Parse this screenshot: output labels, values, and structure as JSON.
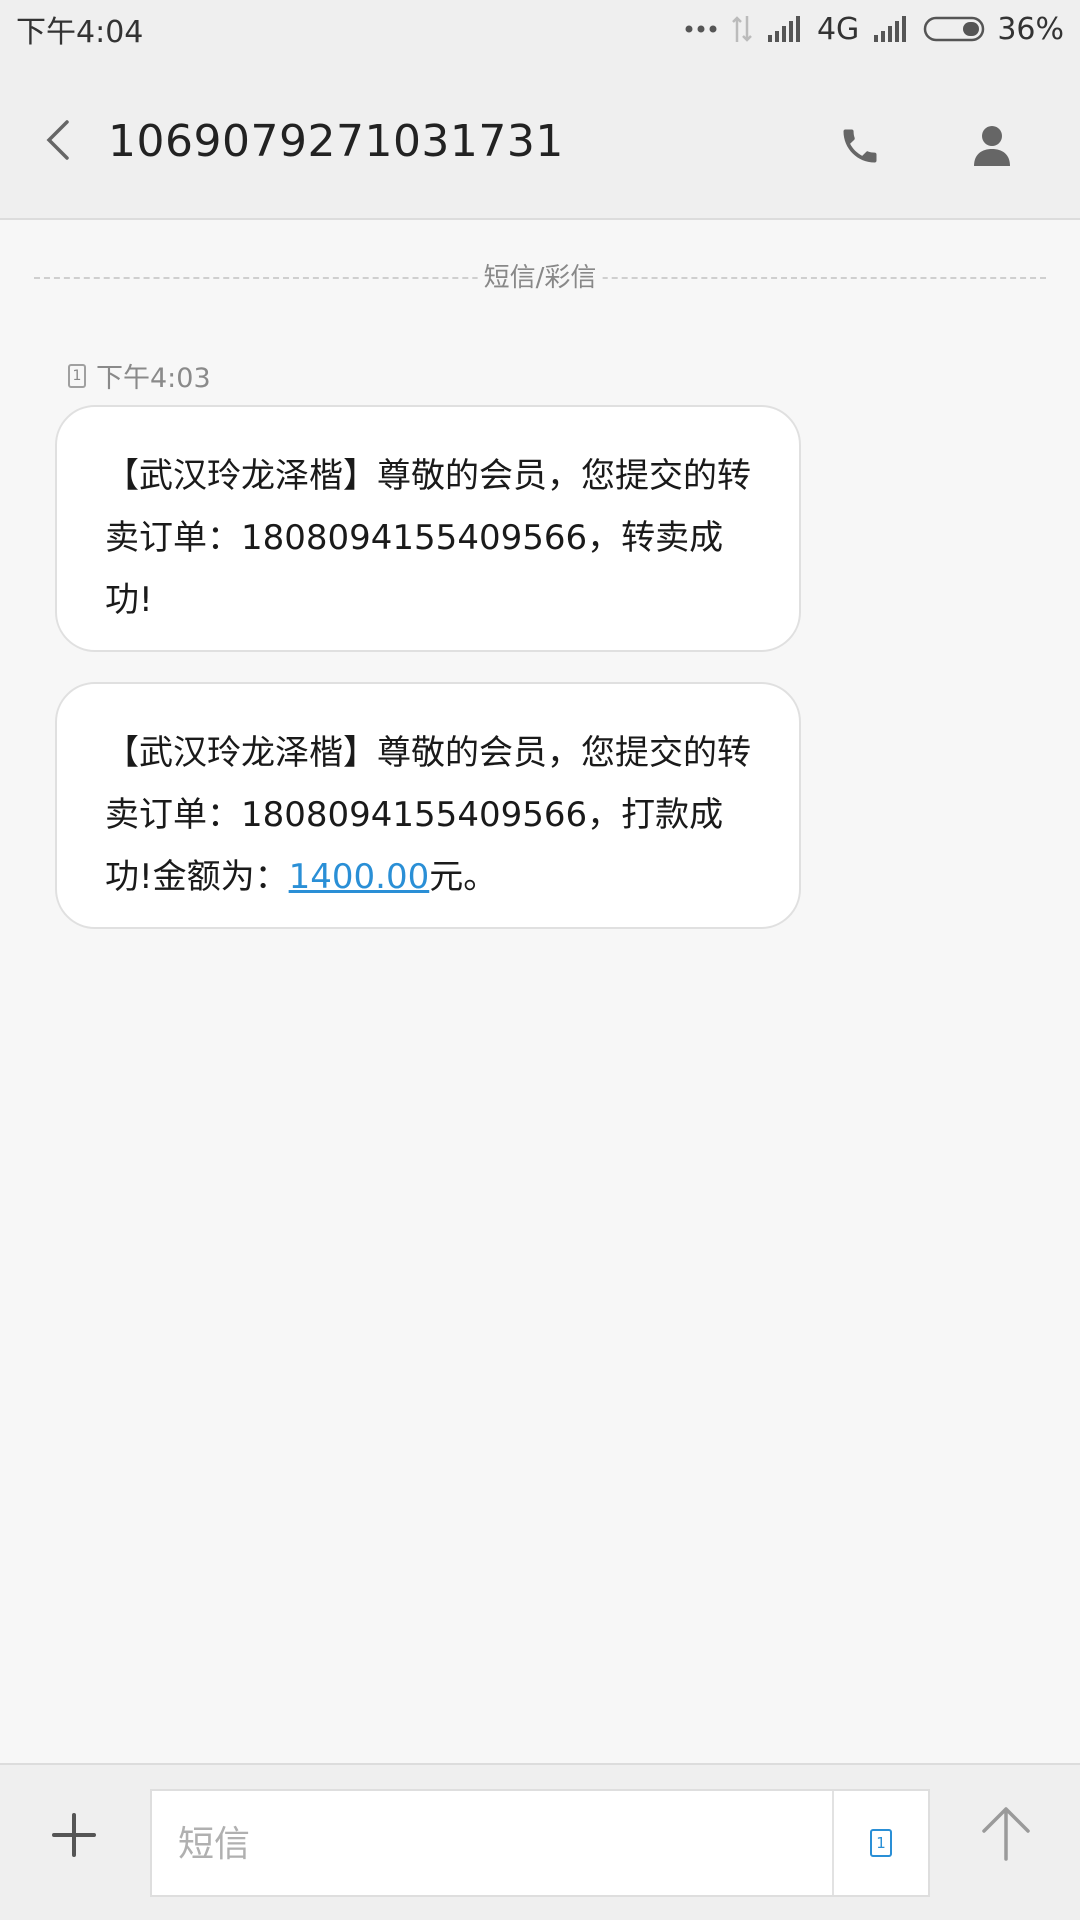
{
  "status_bar": {
    "time": "下午4:04",
    "network": "4G",
    "battery": "36%"
  },
  "header": {
    "title": "1069079271031731",
    "back_icon": "chevron-left-icon",
    "call_icon": "phone-icon",
    "contact_icon": "person-icon"
  },
  "thread": {
    "divider_label": "短信/彩信",
    "timestamp": "下午4:03",
    "sim_slot": "1",
    "messages": [
      {
        "text": "【武汉玲龙泽楷】尊敬的会员，您提交的转卖订单：1808094155409566，转卖成功!"
      },
      {
        "text_before": "【武汉玲龙泽楷】尊敬的会员，您提交的转卖订单：1808094155409566，打款成功!金额为：",
        "amount": "1400.00",
        "text_after": "元。"
      }
    ]
  },
  "composer": {
    "placeholder": "短信",
    "sim_slot": "1",
    "plus_icon": "plus-icon",
    "send_icon": "arrow-up-icon"
  },
  "colors": {
    "accent": "#2a8fd6",
    "background": "#f7f7f7",
    "bar": "#efefef"
  }
}
